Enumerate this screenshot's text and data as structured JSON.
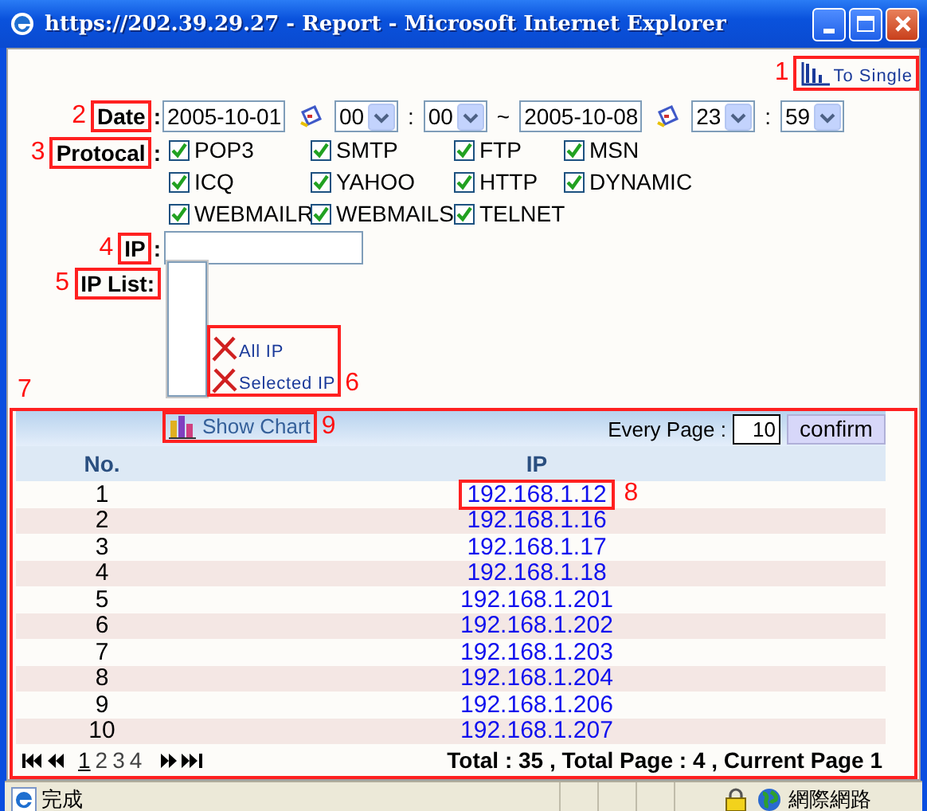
{
  "window": {
    "title": "https://202.39.29.27 - Report - Microsoft Internet Explorer"
  },
  "to_single": {
    "label": "To Single",
    "callout": "1"
  },
  "date": {
    "label": "Date",
    "callout": "2",
    "colon": ":",
    "from": "2005-10-01",
    "from_hour": "00",
    "time_separator": ":",
    "from_minute": "00",
    "range_separator": "~",
    "to": "2005-10-08",
    "to_hour": "23",
    "to_minute": "59"
  },
  "protocol": {
    "label": "Protocal",
    "callout": "3",
    "colon": ":",
    "options": [
      {
        "label": "POP3",
        "checked": true
      },
      {
        "label": "SMTP",
        "checked": true
      },
      {
        "label": "FTP",
        "checked": true
      },
      {
        "label": "MSN",
        "checked": true
      },
      {
        "label": "ICQ",
        "checked": true
      },
      {
        "label": "YAHOO",
        "checked": true
      },
      {
        "label": "HTTP",
        "checked": true
      },
      {
        "label": "DYNAMIC",
        "checked": true
      },
      {
        "label": "WEBMAILR",
        "checked": true
      },
      {
        "label": "WEBMAILS",
        "checked": true
      },
      {
        "label": "TELNET",
        "checked": true
      }
    ]
  },
  "ip": {
    "label": "IP",
    "callout": "4",
    "colon": ":"
  },
  "ip_list": {
    "label": "IP List:",
    "callout": "5"
  },
  "remove_actions": {
    "callout": "6",
    "items": [
      {
        "label": "All IP"
      },
      {
        "label": "Selected IP"
      }
    ]
  },
  "results": {
    "callout": "7",
    "show_chart": {
      "label": "Show Chart",
      "callout": "9"
    },
    "every_page": {
      "label": "Every Page :",
      "value": "10"
    },
    "confirm": "confirm",
    "columns": [
      "No.",
      "IP"
    ],
    "rows": [
      {
        "no": "1",
        "ip": "192.168.1.12",
        "callout": "8"
      },
      {
        "no": "2",
        "ip": "192.168.1.16"
      },
      {
        "no": "3",
        "ip": "192.168.1.17"
      },
      {
        "no": "4",
        "ip": "192.168.1.18"
      },
      {
        "no": "5",
        "ip": "192.168.1.201"
      },
      {
        "no": "6",
        "ip": "192.168.1.202"
      },
      {
        "no": "7",
        "ip": "192.168.1.203"
      },
      {
        "no": "8",
        "ip": "192.168.1.204"
      },
      {
        "no": "9",
        "ip": "192.168.1.206"
      },
      {
        "no": "10",
        "ip": "192.168.1.207"
      }
    ],
    "pages": [
      {
        "label": "1",
        "selected": true
      },
      {
        "label": "2",
        "selected": false
      },
      {
        "label": "3",
        "selected": false
      },
      {
        "label": "4",
        "selected": false
      }
    ],
    "summary": "Total : 35 , Total Page : 4 , Current Page 1"
  },
  "status_bar": {
    "text": "完成",
    "zone": "網際網路"
  }
}
